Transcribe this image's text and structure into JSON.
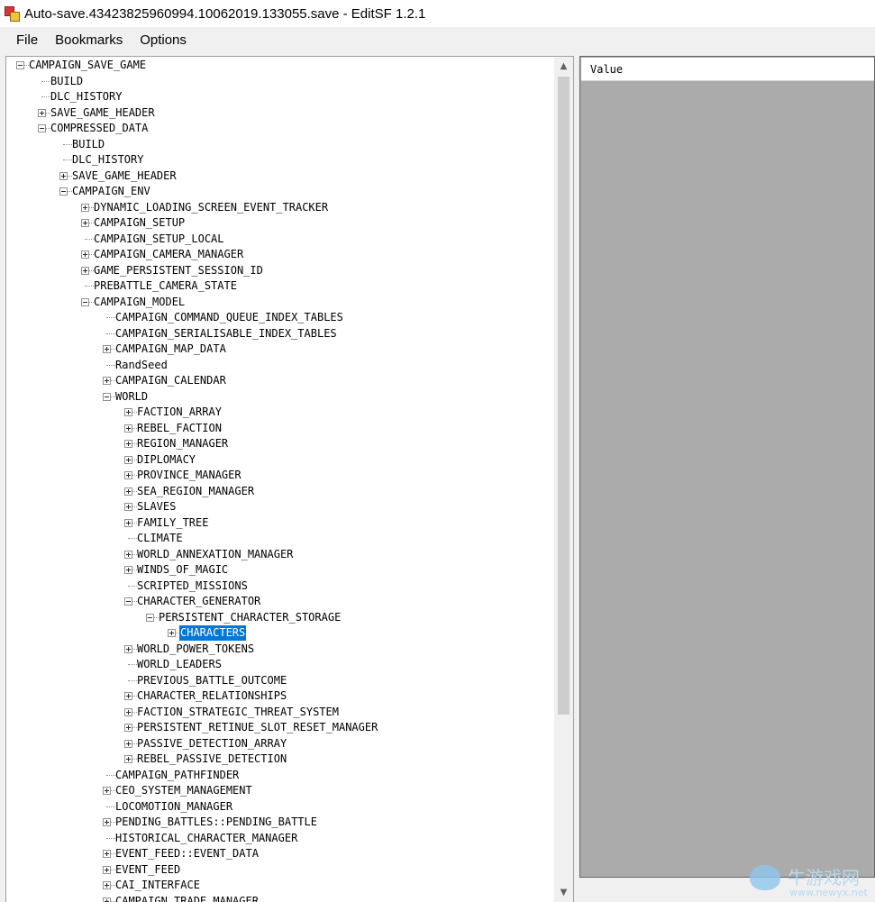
{
  "window": {
    "title": "Auto-save.43423825960994.10062019.133055.save - EditSF 1.2.1"
  },
  "menu": [
    "File",
    "Bookmarks",
    "Options"
  ],
  "tree": [
    {
      "label": "CAMPAIGN_SAVE_GAME",
      "depth": 0,
      "expander": "minus"
    },
    {
      "label": "BUILD",
      "depth": 1,
      "expander": "none"
    },
    {
      "label": "DLC_HISTORY",
      "depth": 1,
      "expander": "none"
    },
    {
      "label": "SAVE_GAME_HEADER",
      "depth": 1,
      "expander": "plus"
    },
    {
      "label": "COMPRESSED_DATA",
      "depth": 1,
      "expander": "minus"
    },
    {
      "label": "BUILD",
      "depth": 2,
      "expander": "none"
    },
    {
      "label": "DLC_HISTORY",
      "depth": 2,
      "expander": "none"
    },
    {
      "label": "SAVE_GAME_HEADER",
      "depth": 2,
      "expander": "plus"
    },
    {
      "label": "CAMPAIGN_ENV",
      "depth": 2,
      "expander": "minus"
    },
    {
      "label": "DYNAMIC_LOADING_SCREEN_EVENT_TRACKER",
      "depth": 3,
      "expander": "plus"
    },
    {
      "label": "CAMPAIGN_SETUP",
      "depth": 3,
      "expander": "plus"
    },
    {
      "label": "CAMPAIGN_SETUP_LOCAL",
      "depth": 3,
      "expander": "none"
    },
    {
      "label": "CAMPAIGN_CAMERA_MANAGER",
      "depth": 3,
      "expander": "plus"
    },
    {
      "label": "GAME_PERSISTENT_SESSION_ID",
      "depth": 3,
      "expander": "plus"
    },
    {
      "label": "PREBATTLE_CAMERA_STATE",
      "depth": 3,
      "expander": "none"
    },
    {
      "label": "CAMPAIGN_MODEL",
      "depth": 3,
      "expander": "minus"
    },
    {
      "label": "CAMPAIGN_COMMAND_QUEUE_INDEX_TABLES",
      "depth": 4,
      "expander": "none"
    },
    {
      "label": "CAMPAIGN_SERIALISABLE_INDEX_TABLES",
      "depth": 4,
      "expander": "none"
    },
    {
      "label": "CAMPAIGN_MAP_DATA",
      "depth": 4,
      "expander": "plus"
    },
    {
      "label": "RandSeed",
      "depth": 4,
      "expander": "none"
    },
    {
      "label": "CAMPAIGN_CALENDAR",
      "depth": 4,
      "expander": "plus"
    },
    {
      "label": "WORLD",
      "depth": 4,
      "expander": "minus"
    },
    {
      "label": "FACTION_ARRAY",
      "depth": 5,
      "expander": "plus"
    },
    {
      "label": "REBEL_FACTION",
      "depth": 5,
      "expander": "plus"
    },
    {
      "label": "REGION_MANAGER",
      "depth": 5,
      "expander": "plus"
    },
    {
      "label": "DIPLOMACY",
      "depth": 5,
      "expander": "plus"
    },
    {
      "label": "PROVINCE_MANAGER",
      "depth": 5,
      "expander": "plus"
    },
    {
      "label": "SEA_REGION_MANAGER",
      "depth": 5,
      "expander": "plus"
    },
    {
      "label": "SLAVES",
      "depth": 5,
      "expander": "plus"
    },
    {
      "label": "FAMILY_TREE",
      "depth": 5,
      "expander": "plus"
    },
    {
      "label": "CLIMATE",
      "depth": 5,
      "expander": "none"
    },
    {
      "label": "WORLD_ANNEXATION_MANAGER",
      "depth": 5,
      "expander": "plus"
    },
    {
      "label": "WINDS_OF_MAGIC",
      "depth": 5,
      "expander": "plus"
    },
    {
      "label": "SCRIPTED_MISSIONS",
      "depth": 5,
      "expander": "none"
    },
    {
      "label": "CHARACTER_GENERATOR",
      "depth": 5,
      "expander": "minus"
    },
    {
      "label": "PERSISTENT_CHARACTER_STORAGE",
      "depth": 6,
      "expander": "minus"
    },
    {
      "label": "CHARACTERS",
      "depth": 7,
      "expander": "plus",
      "selected": true
    },
    {
      "label": "WORLD_POWER_TOKENS",
      "depth": 5,
      "expander": "plus"
    },
    {
      "label": "WORLD_LEADERS",
      "depth": 5,
      "expander": "none"
    },
    {
      "label": "PREVIOUS_BATTLE_OUTCOME",
      "depth": 5,
      "expander": "none"
    },
    {
      "label": "CHARACTER_RELATIONSHIPS",
      "depth": 5,
      "expander": "plus"
    },
    {
      "label": "FACTION_STRATEGIC_THREAT_SYSTEM",
      "depth": 5,
      "expander": "plus"
    },
    {
      "label": "PERSISTENT_RETINUE_SLOT_RESET_MANAGER",
      "depth": 5,
      "expander": "plus"
    },
    {
      "label": "PASSIVE_DETECTION_ARRAY",
      "depth": 5,
      "expander": "plus"
    },
    {
      "label": "REBEL_PASSIVE_DETECTION",
      "depth": 5,
      "expander": "plus"
    },
    {
      "label": "CAMPAIGN_PATHFINDER",
      "depth": 4,
      "expander": "none"
    },
    {
      "label": "CEO_SYSTEM_MANAGEMENT",
      "depth": 4,
      "expander": "plus"
    },
    {
      "label": "LOCOMOTION_MANAGER",
      "depth": 4,
      "expander": "none"
    },
    {
      "label": "PENDING_BATTLES::PENDING_BATTLE",
      "depth": 4,
      "expander": "plus"
    },
    {
      "label": "HISTORICAL_CHARACTER_MANAGER",
      "depth": 4,
      "expander": "none"
    },
    {
      "label": "EVENT_FEED::EVENT_DATA",
      "depth": 4,
      "expander": "plus"
    },
    {
      "label": "EVENT_FEED",
      "depth": 4,
      "expander": "plus"
    },
    {
      "label": "CAI_INTERFACE",
      "depth": 4,
      "expander": "plus"
    },
    {
      "label": "CAMPAIGN_TRADE_MANAGER",
      "depth": 4,
      "expander": "plus"
    }
  ],
  "scrollbar": {
    "up_icon": "scroll-up-arrow",
    "down_icon": "scroll-down-arrow",
    "position": 0.0
  },
  "value_panel": {
    "header": "Value"
  },
  "watermark": {
    "text_cn": "牛游戏网",
    "url": "www.newyx.net"
  },
  "colors": {
    "selection": "#0078d7",
    "value_panel_bg": "#ababab"
  }
}
